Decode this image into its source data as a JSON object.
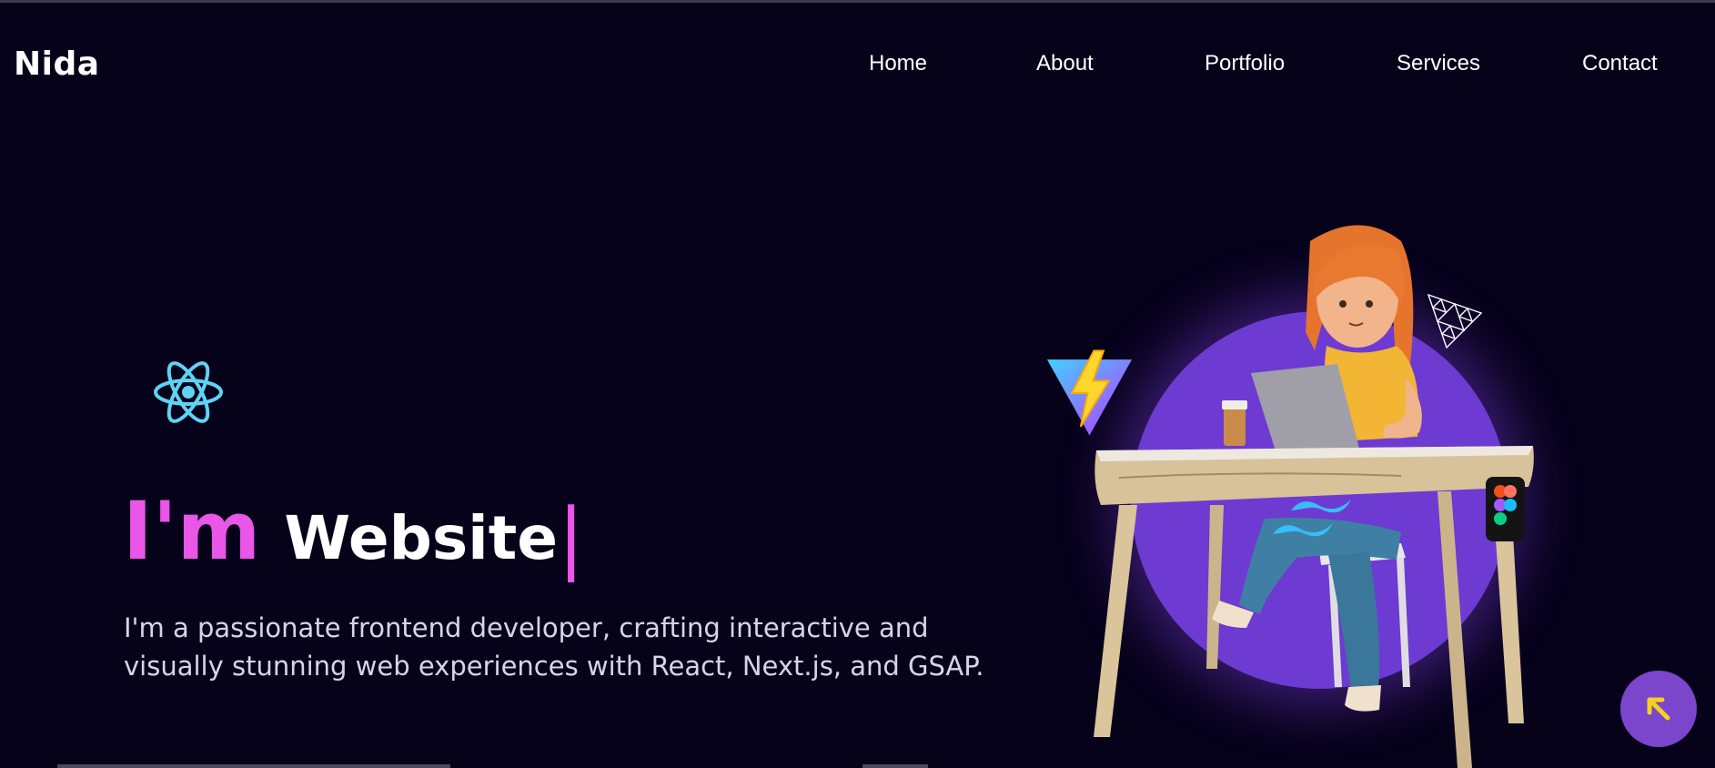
{
  "brand": {
    "name": "Nida"
  },
  "nav": {
    "items": [
      {
        "label": "Home"
      },
      {
        "label": "About"
      },
      {
        "label": "Portfolio"
      },
      {
        "label": "Services"
      },
      {
        "label": "Contact"
      }
    ]
  },
  "hero": {
    "prefix": "I'm",
    "typed_word": "Website",
    "cursor": "|",
    "description": "I'm a passionate frontend developer, crafting interactive and visually stunning web experiences with React, Next.js, and GSAP."
  },
  "icons": {
    "react": "react-icon",
    "vite": "vite-icon",
    "threejs": "threejs-icon",
    "figma": "figma-icon",
    "tailwind": "tailwind-icon",
    "scroll_top": "arrow-up-left-icon"
  },
  "colors": {
    "background": "#06021a",
    "accent_pink": "#e956e8",
    "circle_purple": "#6d3bd1",
    "button_purple": "#7b45cc",
    "arrow_yellow": "#f5d020",
    "react_blue": "#5fd3f3"
  }
}
